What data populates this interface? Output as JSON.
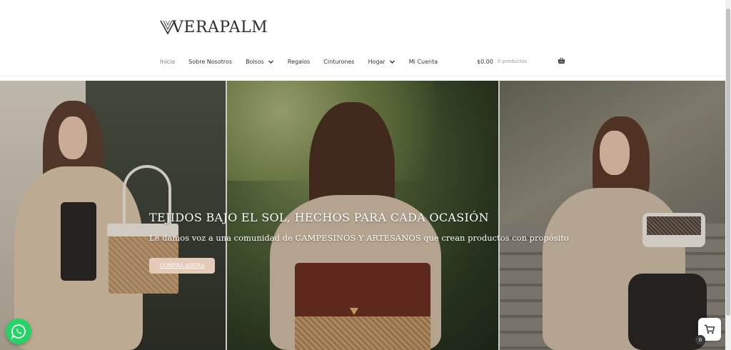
{
  "brand": {
    "logo_text": "VERAPALM"
  },
  "nav": {
    "items": [
      {
        "label": "Inicio",
        "dropdown": false,
        "active": true
      },
      {
        "label": "Sobre Nosotros",
        "dropdown": false
      },
      {
        "label": "Bolsos",
        "dropdown": true
      },
      {
        "label": "Regalos",
        "dropdown": false
      },
      {
        "label": "Cinturones",
        "dropdown": false
      },
      {
        "label": "Hogar",
        "dropdown": true
      },
      {
        "label": "Mi Cuenta",
        "dropdown": false
      }
    ]
  },
  "cart": {
    "amount": "$0.00",
    "count_label": "0 productos",
    "badge": "0"
  },
  "hero": {
    "title": "TEJIDOS BAJO EL SOL, HECHOS PARA CADA OCASIÓN",
    "subtitle": "Le damos voz a una comunidad de CAMPESINOS Y ARTESANOS que crean productos con propósito",
    "button": "COMPRA AHORA"
  },
  "colors": {
    "accent": "#e4cbb7",
    "whatsapp": "#25d366",
    "text": "#333333"
  },
  "icons": {
    "basket": "basket-icon",
    "whatsapp": "whatsapp-icon",
    "cart": "cart-icon",
    "chevron": "chevron-down-icon"
  }
}
